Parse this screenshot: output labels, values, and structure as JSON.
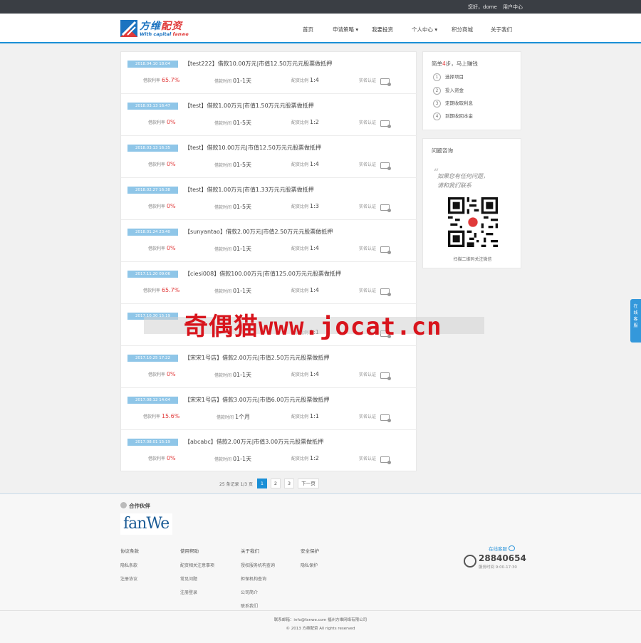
{
  "topbar": {
    "greeting": "您好，dome",
    "user_center": "用户中心"
  },
  "logo": {
    "name_blue": "方维",
    "name_red": "配资",
    "sub_blue": "With capital ",
    "sub_red": "fanwe"
  },
  "nav": [
    {
      "label": "首页"
    },
    {
      "label": "申请策略 ▾"
    },
    {
      "label": "我要投资"
    },
    {
      "label": "个人中心 ▾"
    },
    {
      "label": "积分商城"
    },
    {
      "label": "关于我们"
    }
  ],
  "labels": {
    "rate": "借款利率",
    "term": "借款时间",
    "ratio": "配资比例",
    "auth": "实名认证"
  },
  "loans": [
    {
      "date": "2018.04.10 18:04",
      "title": "【test222】借款10.00万元|市值12.50万元元股票做抵押",
      "rate": "65.7%",
      "rate_red": true,
      "term": "01-1天",
      "ratio": "1:4"
    },
    {
      "date": "2018.03.13 16:47",
      "title": "【test】借款1.00万元|市值1.50万元元股票做抵押",
      "rate": "0%",
      "rate_red": true,
      "term": "01-5天",
      "ratio": "1:2"
    },
    {
      "date": "2018.03.13 16:35",
      "title": "【test】借款10.00万元|市值12.50万元元股票做抵押",
      "rate": "0%",
      "rate_red": true,
      "term": "01-5天",
      "ratio": "1:4"
    },
    {
      "date": "2018.02.27 16:38",
      "title": "【test】借款1.00万元|市值1.33万元元股票做抵押",
      "rate": "0%",
      "rate_red": true,
      "term": "01-5天",
      "ratio": "1:3"
    },
    {
      "date": "2018.01.24 23:40",
      "title": "【sunyantao】借款2.00万元|市值2.50万元元股票做抵押",
      "rate": "0%",
      "rate_red": true,
      "term": "01-1天",
      "ratio": "1:4"
    },
    {
      "date": "2017.11.20 09:06",
      "title": "【ciesi008】借款100.00万元|市值125.00万元元股票做抵押",
      "rate": "65.7%",
      "rate_red": true,
      "term": "01-1天",
      "ratio": "1:4"
    },
    {
      "date": "2017.10.30 15:19",
      "title": "",
      "rate": "",
      "rate_red": true,
      "term": "",
      "ratio": "1:1"
    },
    {
      "date": "2017.10.25 17:22",
      "title": "【宋宋1号店】借款2.00万元|市值2.50万元元股票做抵押",
      "rate": "0%",
      "rate_red": true,
      "term": "01-1天",
      "ratio": "1:4"
    },
    {
      "date": "2017.08.12 14:04",
      "title": "【宋宋1号店】借款3.00万元|市值6.00万元元股票做抵押",
      "rate": "15.6%",
      "rate_red": true,
      "term": "1个月",
      "ratio": "1:1"
    },
    {
      "date": "2017.08.01 15:19",
      "title": "【abcabc】借款2.00万元|市值3.00万元元股票做抵押",
      "rate": "0%",
      "rate_red": true,
      "term": "01-1天",
      "ratio": "1:2"
    }
  ],
  "pager": {
    "info": "25 条记录 1/3 页",
    "pages": [
      "1",
      "2",
      "3"
    ],
    "next": "下一页"
  },
  "steps_box": {
    "title_pre": "简单",
    "title_red": "4",
    "title_post": "步，马上赚钱",
    "steps": [
      "选择项目",
      "投入资金",
      "定期收取利息",
      "到期收回本金"
    ]
  },
  "qa_box": {
    "title": "问题咨询",
    "quote_line1": "如果您有任何问题，",
    "quote_line2": "请和我们联系",
    "qr_caption": "扫描二维码关注微信"
  },
  "float_tab": {
    "label": "在线客服"
  },
  "watermark": {
    "text": "奇偶猫www.jocat.cn"
  },
  "footer": {
    "partners_title": "合作伙伴",
    "partner_logo": "fanWe",
    "cols": [
      {
        "title": "协议条款",
        "items": [
          "隐私条款",
          "注册协议"
        ]
      },
      {
        "title": "使用帮助",
        "items": [
          "配资相关注意事项",
          "常见问题",
          "注册登录"
        ]
      },
      {
        "title": "关于我们",
        "items": [
          "授权服务机构查询",
          "担保机构查询",
          "公司简介",
          "联系我们"
        ]
      },
      {
        "title": "安全保护",
        "items": [
          "隐私保护"
        ]
      }
    ],
    "kefu": "在线客服",
    "phone": "28840654",
    "phone_time": "服务时间 9:00-17:30",
    "contact": "联系邮箱：info@fanwe.com    福州方维网络有限公司",
    "copyright": "© 2013 方维配资 All rights reserved"
  }
}
